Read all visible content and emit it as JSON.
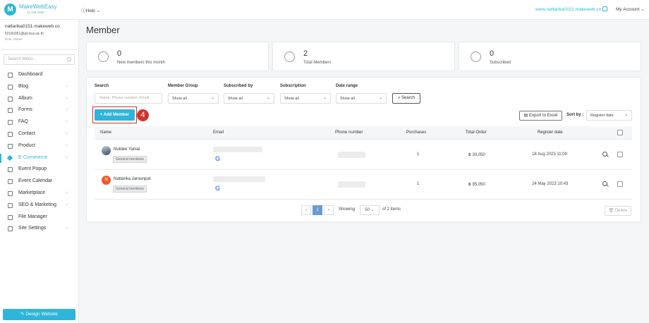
{
  "header": {
    "brand": "MakeWebEasy",
    "version": "v4.148.1652",
    "help": "Help",
    "site_link": "www.nattarika0151.makeweb.co",
    "account": "My Account"
  },
  "user": {
    "site": "nattarika0151.makeweb.co",
    "email": "62160351@go.buu.ac.th",
    "role": "Role: Owner"
  },
  "sidebar": {
    "search_placeholder": "Search Menu...",
    "items": [
      {
        "label": "Dashboard",
        "icon": "home-icon"
      },
      {
        "label": "Blog",
        "icon": "blog-icon"
      },
      {
        "label": "Album",
        "icon": "album-icon"
      },
      {
        "label": "Forms",
        "icon": "forms-icon"
      },
      {
        "label": "FAQ",
        "icon": "faq-icon"
      },
      {
        "label": "Contact",
        "icon": "contact-icon"
      },
      {
        "label": "Product",
        "icon": "cart-icon"
      },
      {
        "label": "E-Commerce",
        "icon": "tag-icon"
      },
      {
        "label": "Event Popup",
        "icon": "megaphone-icon"
      },
      {
        "label": "Event Calendar",
        "icon": "calendar-icon"
      },
      {
        "label": "Marketplace",
        "icon": "store-icon"
      },
      {
        "label": "SEO & Marketing",
        "icon": "search-icon"
      },
      {
        "label": "File Manager",
        "icon": "folder-icon"
      },
      {
        "label": "Site Settings",
        "icon": "gear-icon"
      }
    ],
    "design_button": "Design Website"
  },
  "page": {
    "title": "Member"
  },
  "stats": [
    {
      "value": "0",
      "label": "New members this month"
    },
    {
      "value": "2",
      "label": "Total Members"
    },
    {
      "value": "0",
      "label": "Subscribed"
    }
  ],
  "filters": {
    "search_label": "Search",
    "search_placeholder": "Name, Phone number, Email",
    "group_label": "Member Group",
    "group_value": "Show all",
    "subscribed_by_label": "Subscribed by",
    "subscribed_by_value": "Show all",
    "subscription_label": "Subscription",
    "subscription_value": "Show all",
    "date_label": "Date range",
    "date_value": "Show all",
    "search_button": "Search"
  },
  "actions": {
    "add_member": "+ Add Member",
    "step": "4",
    "export": "Export to Excel",
    "sort_label": "Sort by :",
    "sort_value": "Register date"
  },
  "table": {
    "headers": [
      "Name",
      "Email",
      "Phone number",
      "Purchases",
      "Total Order",
      "Register date"
    ],
    "rows": [
      {
        "name": "Nutdee Yamai",
        "group": "General members",
        "purchases": "1",
        "total": "฿ 30,050",
        "date": "18 Aug 2023 11:09"
      },
      {
        "name": "Nattarika Jaroenpat",
        "initial": "N",
        "group": "General members",
        "purchases": "1",
        "total": "฿ 95,050",
        "date": "24 May 2023 10:43"
      }
    ]
  },
  "pagination": {
    "prev": "‹",
    "page": "1",
    "next": "›",
    "showing": "Showing",
    "per_page": "50",
    "of_items": "of 2 items",
    "delete": "Delete"
  },
  "colors": {
    "accent": "#2fb5d9",
    "highlight": "#d0352c"
  }
}
